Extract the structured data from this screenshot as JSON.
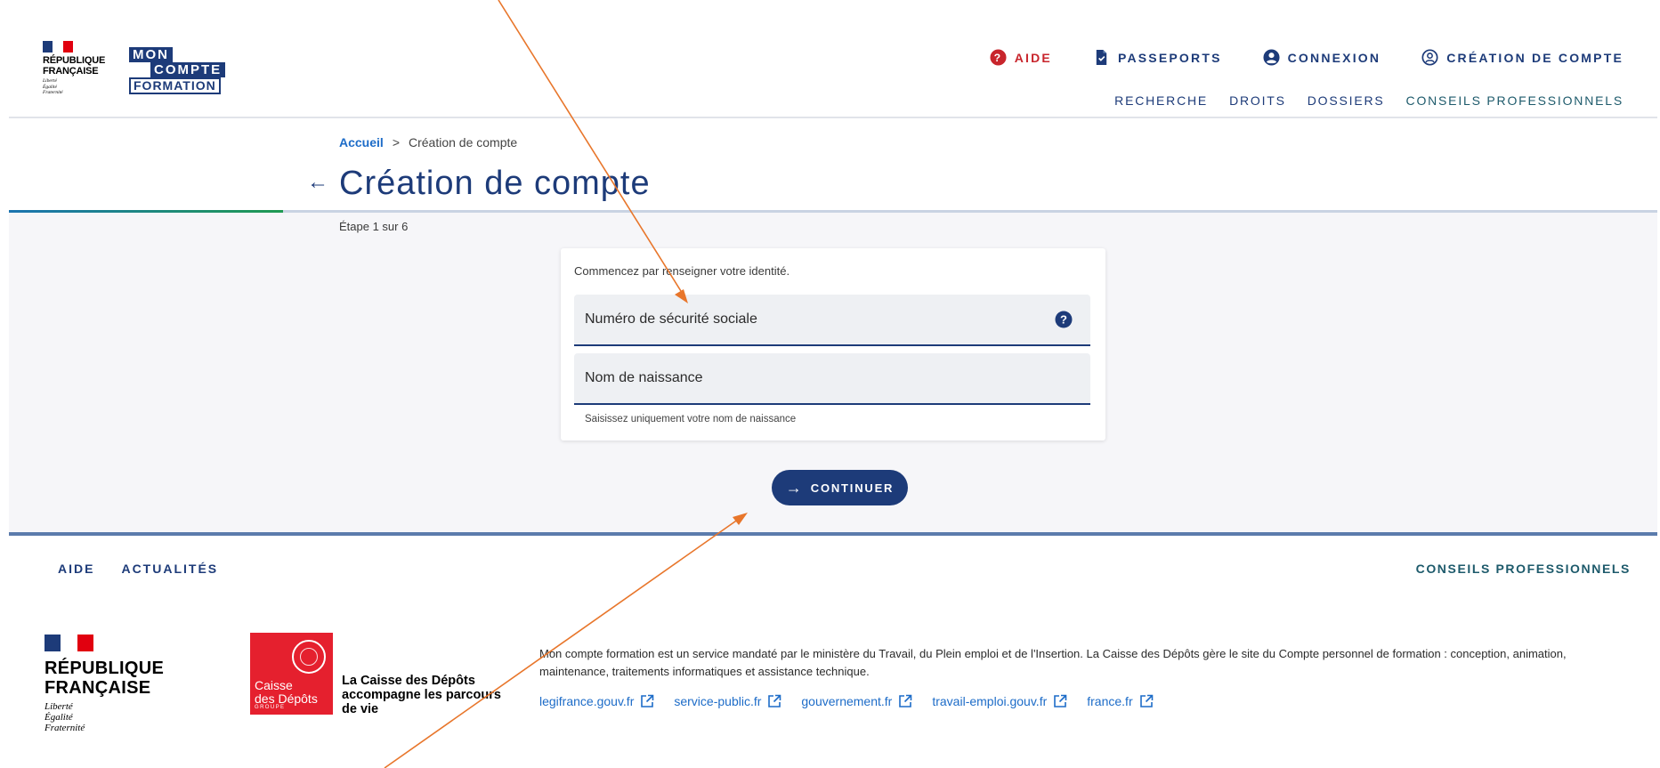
{
  "header": {
    "republique": {
      "line1": "RÉPUBLIQUE",
      "line2": "FRANÇAISE",
      "motto": [
        "Liberté",
        "Égalité",
        "Fraternité"
      ]
    },
    "mcf": {
      "mon": "MON",
      "compte": "COMPTE",
      "formation": "FORMATION"
    },
    "topnav": {
      "aide": "AIDE",
      "passeports": "PASSEPORTS",
      "connexion": "CONNEXION",
      "creation": "CRÉATION DE COMPTE"
    },
    "subnav": {
      "recherche": "RECHERCHE",
      "droits": "DROITS",
      "dossiers": "DOSSIERS",
      "conseils": "CONSEILS PROFESSIONNELS"
    }
  },
  "breadcrumb": {
    "home": "Accueil",
    "separator": ">",
    "current": "Création de compte"
  },
  "page": {
    "title": "Création de compte",
    "step": "Étape 1 sur 6",
    "progress": 0.1667
  },
  "form": {
    "intro": "Commencez par renseigner votre identité.",
    "nss_placeholder": "Numéro de sécurité sociale",
    "nom_placeholder": "Nom de naissance",
    "nom_hint": "Saisissez uniquement votre nom de naissance",
    "continue": "CONTINUER"
  },
  "footer": {
    "nav": {
      "aide": "AIDE",
      "actualites": "ACTUALITÉS",
      "conseils": "CONSEILS PROFESSIONNELS"
    },
    "republique": {
      "line1": "RÉPUBLIQUE",
      "line2": "FRANÇAISE",
      "motto": [
        "Liberté",
        "Égalité",
        "Fraternité"
      ]
    },
    "cdc": {
      "line1": "Caisse",
      "line2": "des Dépôts",
      "groupe": "GROUPE",
      "tagline": "La Caisse des Dépôts accompagne les parcours de vie"
    },
    "description": "Mon compte formation est un service mandaté par le ministère du Travail, du Plein emploi et de l'Insertion. La Caisse des Dépôts gère le site du Compte personnel de formation : conception, animation, maintenance, traitements informatiques et assistance technique.",
    "links": [
      "legifrance.gouv.fr",
      "service-public.fr",
      "gouvernement.fr",
      "travail-emploi.gouv.fr",
      "france.fr"
    ]
  },
  "colors": {
    "primary": "#1d3b79",
    "aide_red": "#c8252c",
    "link_blue": "#1d6cc8",
    "annotation_arrow": "#e8762b"
  }
}
